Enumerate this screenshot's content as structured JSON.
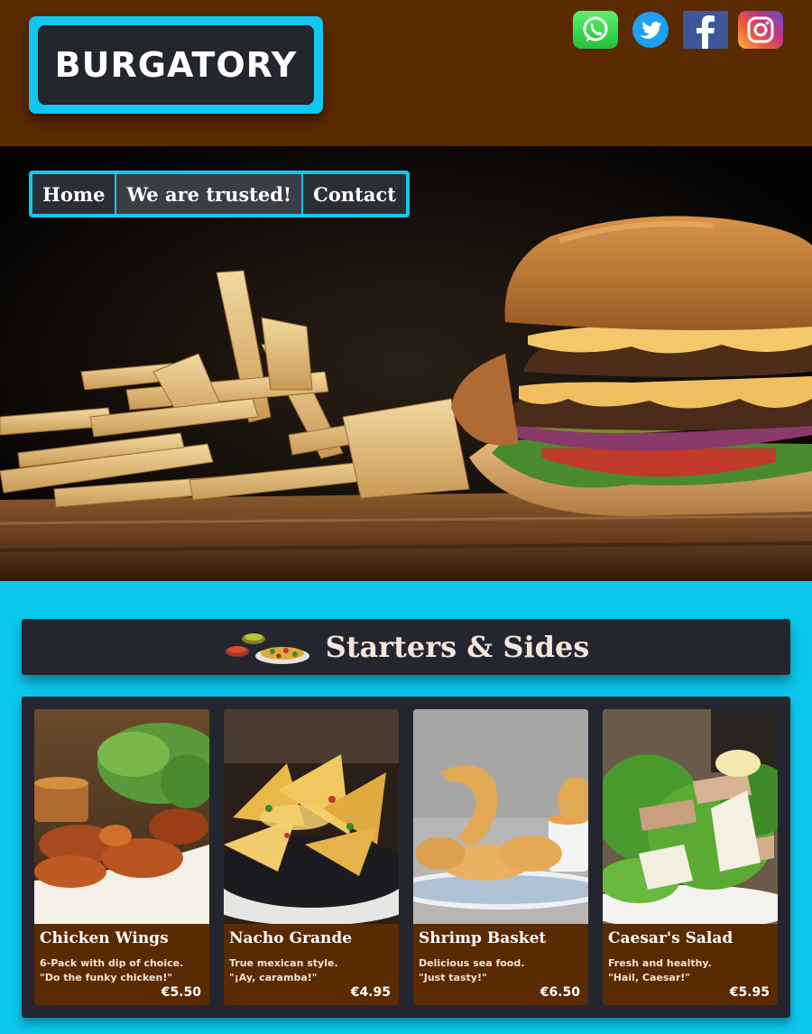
{
  "header": {
    "logo": "BURGATORY",
    "social": [
      {
        "name": "whatsapp",
        "icon": "whatsapp-icon"
      },
      {
        "name": "twitter",
        "icon": "twitter-icon"
      },
      {
        "name": "facebook",
        "icon": "facebook-icon"
      },
      {
        "name": "instagram",
        "icon": "instagram-icon"
      }
    ]
  },
  "nav": {
    "items": [
      {
        "label": "Home"
      },
      {
        "label": "We are trusted!"
      },
      {
        "label": "Contact"
      }
    ]
  },
  "section": {
    "title": "Starters & Sides",
    "icon": "sides-dish-icon"
  },
  "menu": {
    "items": [
      {
        "name": "Chicken Wings",
        "desc1": "6-Pack with dip of choice.",
        "desc2": "\"Do the funky chicken!\"",
        "price": "€5.50"
      },
      {
        "name": "Nacho Grande",
        "desc1": "True mexican style.",
        "desc2": "\"¡Ay, caramba!\"",
        "price": "€4.95"
      },
      {
        "name": "Shrimp Basket",
        "desc1": "Delicious sea food.",
        "desc2": "\"Just tasty!\"",
        "price": "€6.50"
      },
      {
        "name": "Caesar's Salad",
        "desc1": "Fresh and healthy.",
        "desc2": "\"Hail, Caesar!\"",
        "price": "€5.95"
      }
    ]
  },
  "colors": {
    "header_bg": "#5a2a02",
    "accent": "#0bc7ec",
    "dark_panel": "#23262e",
    "card_bg": "#5a2a02"
  }
}
